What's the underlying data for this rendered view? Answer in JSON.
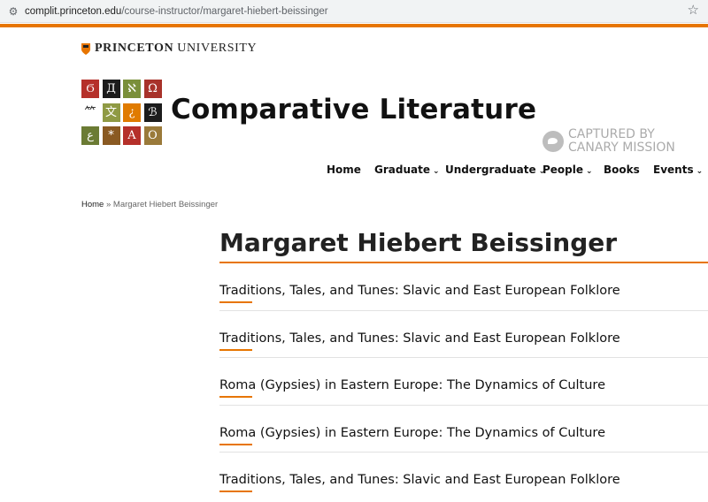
{
  "browser": {
    "url_host": "complit.princeton.edu",
    "url_path": "/course-instructor/margaret-hiebert-beissinger",
    "site_info_icon": "tune-icon",
    "bookmark_icon": "star-icon"
  },
  "header": {
    "university_bold": "PRINCETON",
    "university_rest": " UNIVERSITY",
    "department": "Comparative Literature",
    "logo_glyphs": [
      {
        "char": "Ϭ",
        "bg": "#b5302a"
      },
      {
        "char": "Д",
        "bg": "#1c1c1c"
      },
      {
        "char": "ℵ",
        "bg": "#7a8f3a"
      },
      {
        "char": "Ω",
        "bg": "#a8322a"
      },
      {
        "char": "⺮",
        "bg": "#ffffff",
        "fg": "#1c1c1c"
      },
      {
        "char": "文",
        "bg": "#8f9a44"
      },
      {
        "char": "¿",
        "bg": "#e07b00"
      },
      {
        "char": "ℬ",
        "bg": "#1c1c1c"
      },
      {
        "char": "ع",
        "bg": "#6b7b34"
      },
      {
        "char": "*",
        "bg": "#8a5a22"
      },
      {
        "char": "A",
        "bg": "#b5302a"
      },
      {
        "char": "O",
        "bg": "#9a7a3a"
      }
    ]
  },
  "watermark": {
    "line1": "CAPTURED BY",
    "line2": "CANARY MISSION"
  },
  "nav": {
    "items": [
      {
        "label": "Home"
      },
      {
        "label": "Graduate",
        "caret": "⌄"
      },
      {
        "label": "Undergraduate",
        "caret": "⌄"
      },
      {
        "label": "People",
        "caret": "⌄"
      },
      {
        "label": "Books"
      },
      {
        "label": "Events",
        "caret": "⌄"
      }
    ]
  },
  "breadcrumb": {
    "home": "Home",
    "sep": " » ",
    "current": "Margaret Hiebert Beissinger"
  },
  "main": {
    "title": "Margaret Hiebert Beissinger",
    "courses": [
      "Traditions, Tales, and Tunes: Slavic and East European Folklore",
      "Traditions, Tales, and Tunes: Slavic and East European Folklore",
      "Roma (Gypsies) in Eastern Europe: The Dynamics of Culture",
      "Roma (Gypsies) in Eastern Europe: The Dynamics of Culture",
      "Traditions, Tales, and Tunes: Slavic and East European Folklore"
    ]
  },
  "colors": {
    "accent_orange": "#e77500"
  }
}
